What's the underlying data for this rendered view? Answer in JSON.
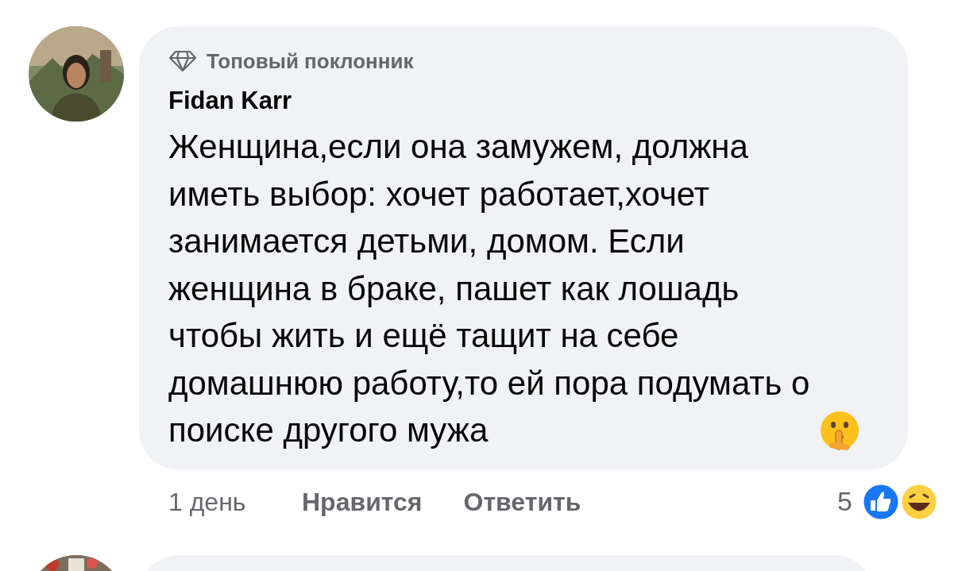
{
  "comments": [
    {
      "badge": "Топовый поклонник",
      "author": "Fidan Karr",
      "text": "Женщина,если она замужем, должна иметь выбор: хочет работает,хочет занимается детьми, домом. Если женщина в браке, пашет как лошадь чтобы жить и ещё тащит на себе домашнюю работу,то ей пора подумать о поиске другого мужа",
      "time": "1 день",
      "actions": [
        "Нравится",
        "Ответить"
      ],
      "reaction_count": "5"
    }
  ]
}
